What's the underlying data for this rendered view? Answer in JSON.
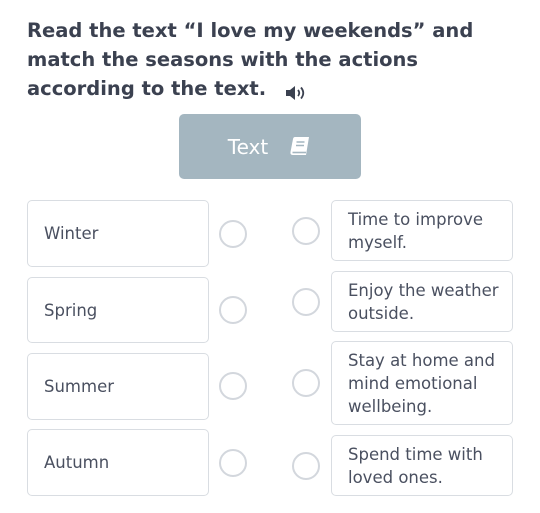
{
  "instruction": "Read the text “I love my weekends” and match the seasons with the actions according to the text.",
  "text_button": {
    "label": "Text"
  },
  "seasons": [
    "Winter",
    "Spring",
    "Summer",
    "Autumn"
  ],
  "actions": [
    "Time to improve myself.",
    "Enjoy the weather outside.",
    "Stay at home and mind emotional wellbeing.",
    "Spend time with loved ones."
  ],
  "icons": {
    "audio": "speaker-icon",
    "text": "book-icon"
  },
  "colors": {
    "button_bg": "#a4b6c0",
    "border": "#d9dde2",
    "text": "#3b4150"
  }
}
